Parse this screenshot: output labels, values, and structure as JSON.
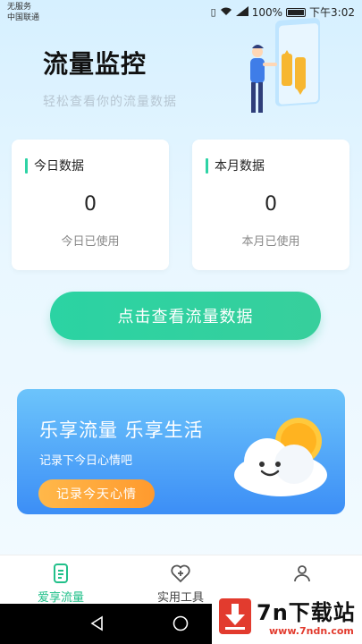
{
  "status_bar": {
    "carrier_line1": "无服务",
    "carrier_line2": "中国联通",
    "battery": "100%",
    "time": "下午3:02"
  },
  "header": {
    "title": "流量监控",
    "subtitle": "轻松查看你的流量数据"
  },
  "cards": [
    {
      "label": "今日数据",
      "value": "0",
      "desc": "今日已使用"
    },
    {
      "label": "本月数据",
      "value": "0",
      "desc": "本月已使用"
    }
  ],
  "main_button": {
    "label": "点击查看流量数据"
  },
  "banner": {
    "title": "乐享流量 乐享生活",
    "subtitle": "记录下今日心情吧",
    "button": "记录今天心情"
  },
  "bottom_nav": {
    "items": [
      {
        "label": "爱享流量",
        "icon": "document-icon",
        "active": true
      },
      {
        "label": "实用工具",
        "icon": "heart-plus-icon",
        "active": false
      },
      {
        "label": "",
        "icon": "person-icon",
        "active": false
      }
    ]
  },
  "watermark": {
    "text": "7n下载站",
    "url": "www.7ndn.com"
  },
  "colors": {
    "accent": "#2ed3a5",
    "banner_top": "#6cc4fb",
    "banner_bottom": "#3c8ef6",
    "orange": "#ffa03a"
  }
}
